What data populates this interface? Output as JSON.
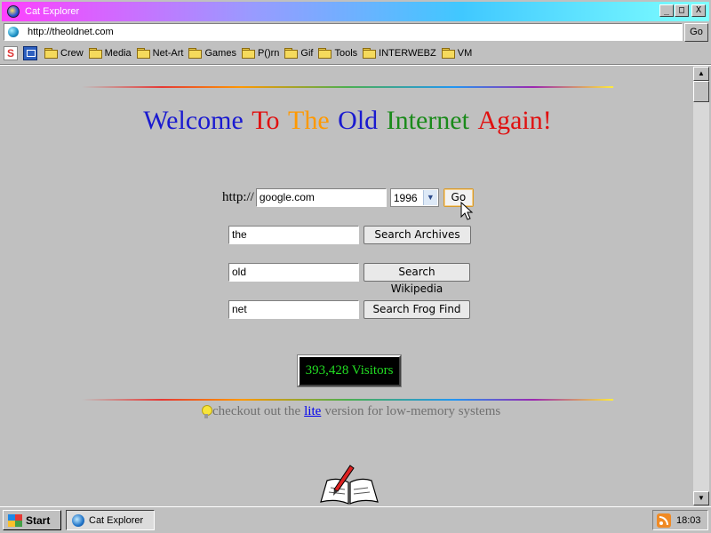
{
  "window": {
    "title": "Cat Explorer",
    "controls": {
      "minimize": "_",
      "maximize": "□",
      "close": "X"
    }
  },
  "address_bar": {
    "url": "http://theoldnet.com",
    "go_label": "Go"
  },
  "bookmarks": {
    "items": [
      "Crew",
      "Media",
      "Net-Art",
      "Games",
      "P()rn",
      "Gif",
      "Tools",
      "INTERWEBZ",
      "VM"
    ]
  },
  "page": {
    "welcome_words": [
      "Welcome",
      "To",
      "The",
      "Old",
      "Internet",
      "Again!"
    ],
    "welcome_colors": [
      "#1a1ad0",
      "#e01010",
      "#ff9900",
      "#1a1ad0",
      "#1a8a1a",
      "#e01010"
    ],
    "wayback": {
      "prefix": "http://",
      "url_value": "google.com",
      "year": "1996",
      "go_label": "Go"
    },
    "searches": [
      {
        "value": "the",
        "button": "Search Archives"
      },
      {
        "value": "old",
        "button": "Search Wikipedia"
      },
      {
        "value": "net",
        "button": "Search Frog Find"
      }
    ],
    "counter": "393,428 Visitors",
    "lite_pre": "checkout out the",
    "lite_link": "lite",
    "lite_post": "version for low-memory systems"
  },
  "taskbar": {
    "start_label": "Start",
    "task_label": "Cat Explorer",
    "clock": "18:03"
  }
}
